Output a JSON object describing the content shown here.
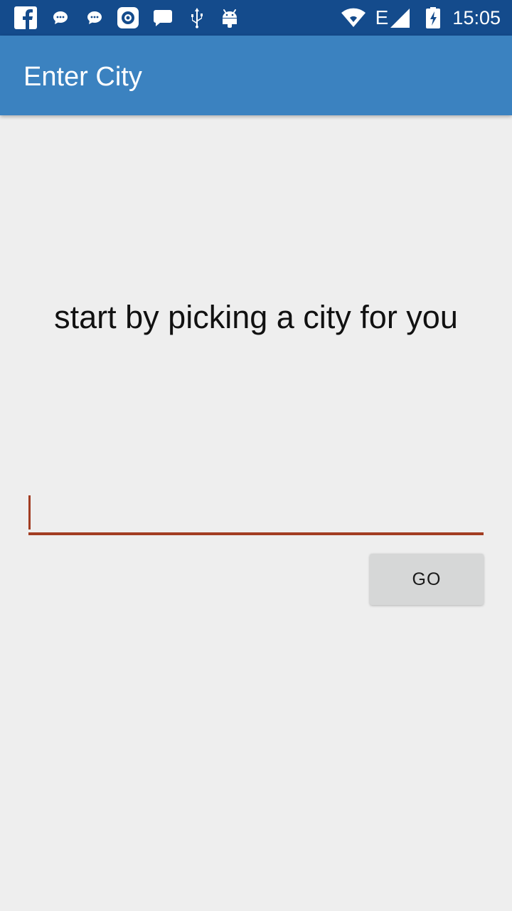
{
  "status_bar": {
    "icons_left": [
      "facebook-icon",
      "chat-bubble-icon",
      "chat-bubble-icon",
      "camera-app-icon",
      "message-icon",
      "usb-icon",
      "android-debug-icon"
    ],
    "icons_right": [
      "wifi-icon",
      "signal-icon",
      "battery-charging-icon"
    ],
    "network_type": "E",
    "time": "15:05"
  },
  "app_bar": {
    "title": "Enter City",
    "color": "#3b82c0"
  },
  "main": {
    "prompt": "start by picking a city for you",
    "city_input": {
      "value": "",
      "placeholder": ""
    },
    "go_button_label": "GO",
    "accent_color": "#a23d22"
  }
}
